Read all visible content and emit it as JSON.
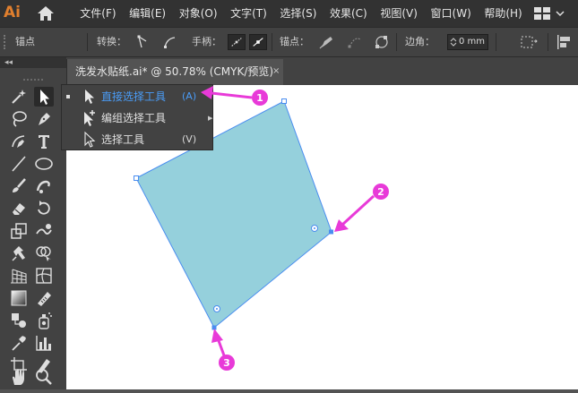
{
  "app": {
    "logo": "Ai",
    "brand_color": "#e07f2e"
  },
  "menu": {
    "items": [
      "文件(F)",
      "编辑(E)",
      "对象(O)",
      "文字(T)",
      "选择(S)",
      "效果(C)",
      "视图(V)",
      "窗口(W)",
      "帮助(H)"
    ]
  },
  "control_bar": {
    "title": "锚点",
    "convert_label": "转换：",
    "handles_label": "手柄：",
    "anchor_label": "锚点：",
    "corner_label": "边角：",
    "corner_value": "0 mm"
  },
  "document": {
    "tab_title": "洗发水贴纸.ai* @ 50.78% (CMYK/预览)",
    "close": "×"
  },
  "flyout": {
    "items": [
      {
        "label": "直接选择工具",
        "shortcut": "(A)",
        "selected": true,
        "icon": "direct-selection-icon"
      },
      {
        "label": "编组选择工具",
        "shortcut": "",
        "selected": false,
        "icon": "group-selection-icon"
      },
      {
        "label": "选择工具",
        "shortcut": "(V)",
        "selected": false,
        "icon": "selection-icon"
      }
    ],
    "selected_color": "#4a9df8"
  },
  "callouts": [
    "1",
    "2",
    "3"
  ],
  "colors": {
    "shape_fill": "#95d0dc",
    "path_stroke": "#4a8df0",
    "callout": "#e83ad8",
    "menubar": "#323232",
    "panel": "#424242",
    "canvas": "#ffffff"
  },
  "toolbar": {
    "collapse_glyph": "◂◂",
    "tools": [
      "magic-wand-icon",
      "direct-selection-icon",
      "lasso-icon",
      "pen-icon",
      "curvature-icon",
      "type-icon",
      "line-icon",
      "ellipse-icon",
      "paintbrush-icon",
      "blob-brush-icon",
      "eraser-icon",
      "rotate-icon",
      "scale-icon",
      "warp-icon",
      "puppet-warp-icon",
      "shape-builder-icon",
      "perspective-grid-icon",
      "mesh-icon",
      "gradient-icon",
      "eyedropper-ruler-icon",
      "blend-icon",
      "symbol-sprayer-icon",
      "eyedropper-icon",
      "column-graph-icon",
      "artboard-icon",
      "slice-icon",
      "hand-icon",
      "zoom-icon"
    ]
  }
}
